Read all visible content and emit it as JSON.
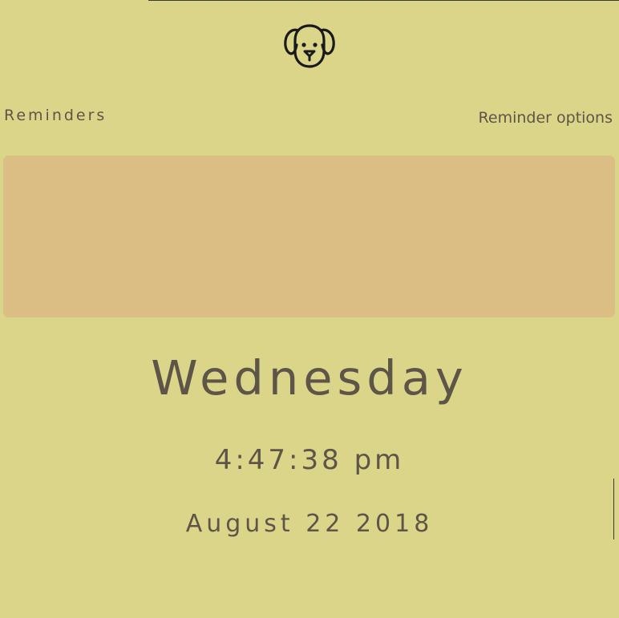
{
  "header": {
    "logo_icon": "dog-face-icon"
  },
  "reminders": {
    "title": "Reminders",
    "options_label": "Reminder options",
    "panel_color": "#dbbe84"
  },
  "clock": {
    "day": "Wednesday",
    "time": "4:47:38 pm",
    "date": "August 22 2018"
  },
  "colors": {
    "background": "#dbd58a",
    "text": "#5e5548"
  }
}
